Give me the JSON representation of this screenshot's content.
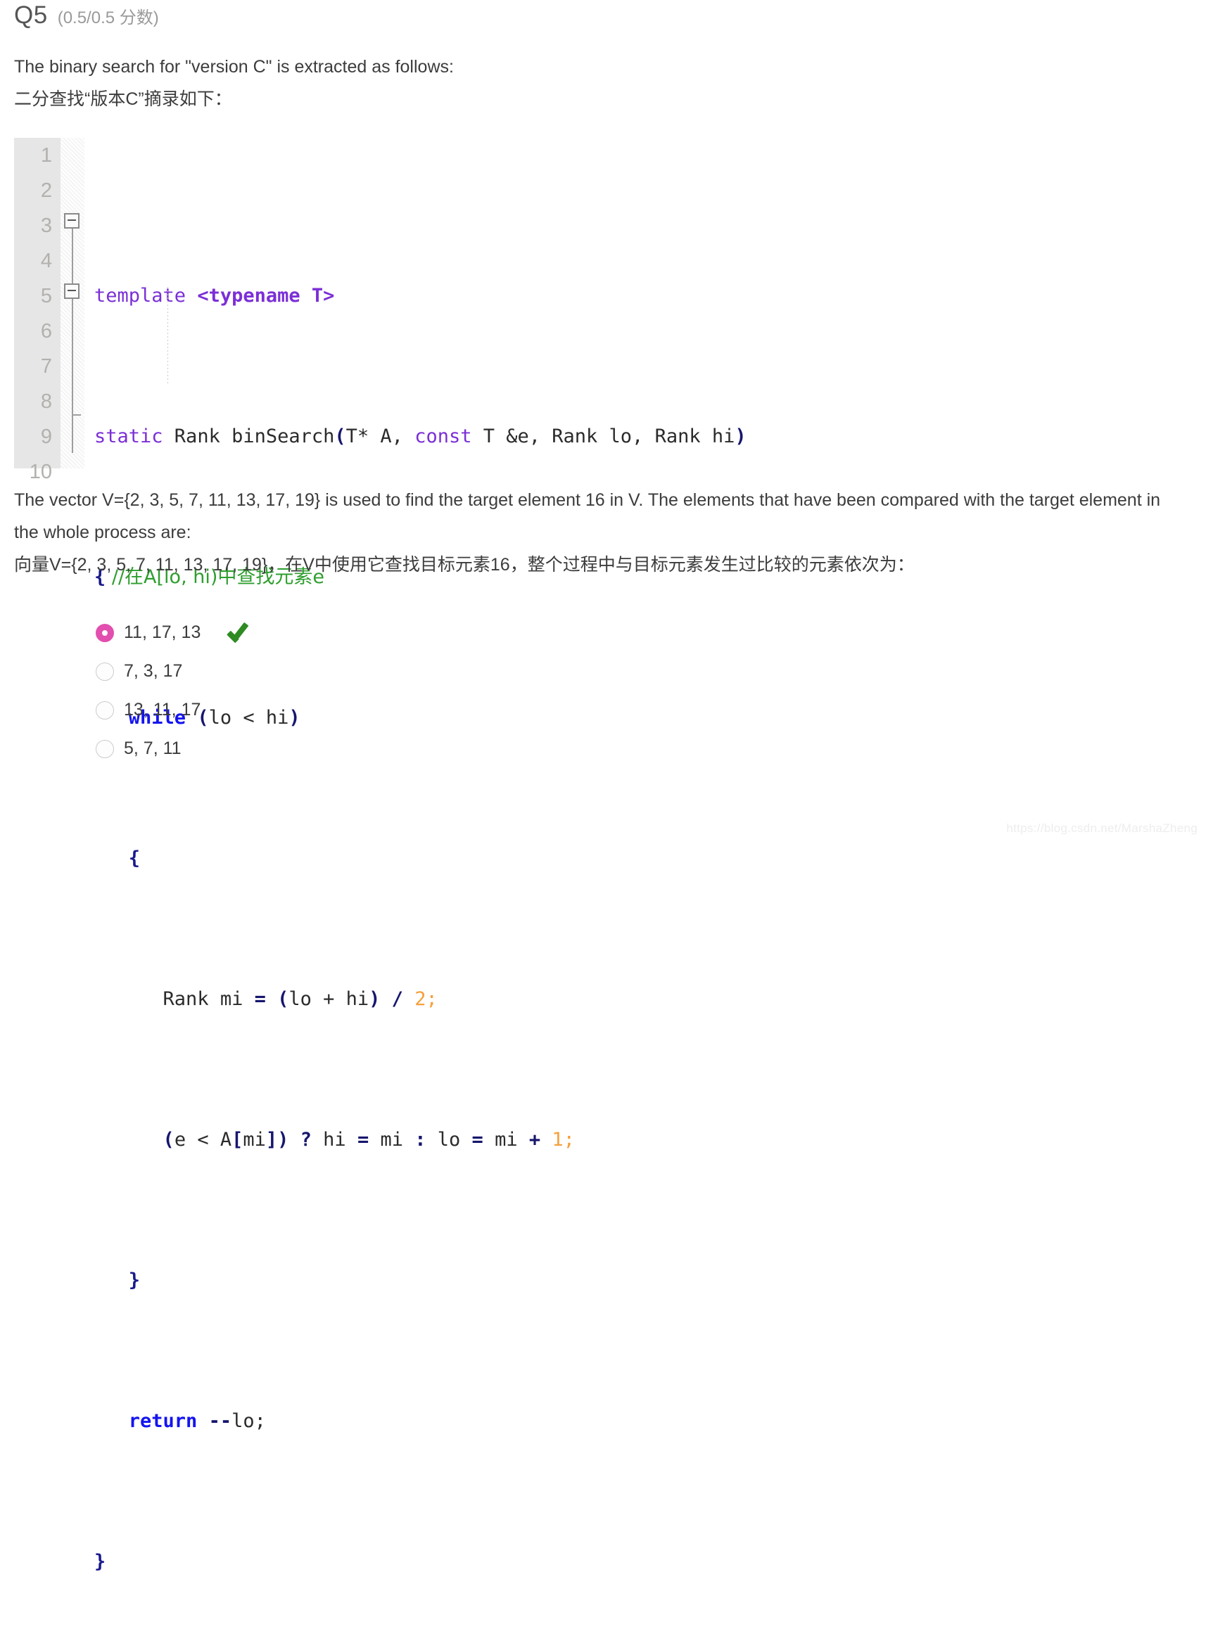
{
  "question": {
    "number": "Q5",
    "score": "(0.5/0.5 分数)"
  },
  "prompt": {
    "en_line1": "The binary search for \"version C\" is extracted as follows:",
    "cn_line1": "二分查找“版本C”摘录如下：",
    "en_line2": "The vector V={2, 3, 5, 7, 11, 13, 17, 19} is used to find the target element 16 in V. The elements that have been compared with the target element in the whole process are:",
    "cn_line2": "向量V={2, 3, 5, 7, 11, 13, 17, 19}，在V中使用它查找目标元素16，整个过程中与目标元素发生过比较的元素依次为："
  },
  "code": {
    "line_numbers": [
      "1",
      "2",
      "3",
      "4",
      "5",
      "6",
      "7",
      "8",
      "9",
      "10"
    ],
    "lines": [
      "template <typename T>",
      "static Rank binSearch(T* A, const T &e, Rank lo, Rank hi)",
      "{ //在A[lo, hi)中查找元素e",
      "   while (lo < hi)",
      "   {",
      "      Rank mi = (lo + hi) / 2;",
      "      (e < A[mi]) ? hi = mi : lo = mi + 1;",
      "   }",
      "   return --lo;",
      "}"
    ],
    "tokens": {
      "l1_kw": "template",
      "l1_typename": "<typename T>",
      "l2_static": "static",
      "l2_rank": " Rank binSearch",
      "l2_paren_open": "(",
      "l2_targ": "T* A, ",
      "l2_const": "const",
      "l2_rest": " T &e, Rank lo, Rank hi",
      "l2_paren_close": ")",
      "l3_brace": "{",
      "l3_comment": " //在A[lo, hi)中查找元素e",
      "l4_while": "while",
      "l4_cond_open": " (",
      "l4_cond_text": "lo < hi",
      "l4_cond_close": ")",
      "l5_brace": "{",
      "l6_rank": "Rank mi ",
      "l6_eq": "= (",
      "l6_expr": "lo + hi",
      "l6_close": ") / ",
      "l6_num": "2;",
      "l7_open": "(",
      "l7_expr1": "e < A",
      "l7_br_open": "[",
      "l7_mi": "mi",
      "l7_br_close": "]",
      "l7_close": ") ",
      "l7_q": "? ",
      "l7_hi": "hi ",
      "l7_eq1": "= ",
      "l7_mi2": "mi ",
      "l7_colon": ": ",
      "l7_lo": "lo ",
      "l7_eq2": "= ",
      "l7_mi3": "mi ",
      "l7_plus": "+ ",
      "l7_num": "1;",
      "l8_brace": "}",
      "l9_return": "return",
      "l9_dec": " --",
      "l9_lo": "lo;",
      "l10_brace": "}"
    },
    "colors": {
      "keyword": "#7b2fd6",
      "control": "#1414f0",
      "punctuation": "#16166e",
      "number": "#f5a03c",
      "comment": "#2e9e2e",
      "gutter_bg": "#e6e6e6",
      "line_number": "#b3b1ae"
    }
  },
  "options": [
    {
      "label": "11, 17, 13",
      "selected": true,
      "correct": true
    },
    {
      "label": "7, 3, 17",
      "selected": false,
      "correct": false
    },
    {
      "label": "13, 11, 17",
      "selected": false,
      "correct": false
    },
    {
      "label": "5, 7, 11",
      "selected": false,
      "correct": false
    }
  ],
  "ui": {
    "selected_radio_color": "#e24fae",
    "check_color": "#2e8b22",
    "watermark": "https://blog.csdn.net/MarshaZheng"
  }
}
